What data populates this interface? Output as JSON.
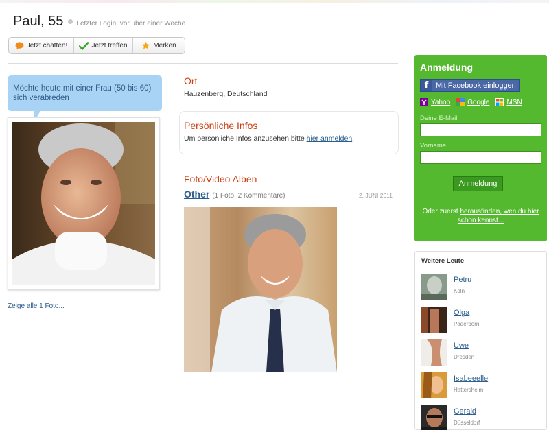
{
  "profile": {
    "name": "Paul, 55",
    "last_login": "Letzter Login: vor über einer Woche"
  },
  "actions": [
    {
      "label": "Jetzt chatten!",
      "icon": "chat-bubble-icon"
    },
    {
      "label": "Jetzt treffen",
      "icon": "checkmark-icon"
    },
    {
      "label": "Merken",
      "icon": "star-icon"
    }
  ],
  "bubble_text": "Möchte heute mit einer Frau (50 bis 60) sich verabreden",
  "show_all_photos": "Zeige alle 1 Foto...",
  "location": {
    "title": "Ort",
    "value": "Hauzenberg, Deutschland"
  },
  "personal_info": {
    "title": "Persönliche Infos",
    "text_before": "Um persönliche Infos anzusehen bitte ",
    "link": "hier anmelden",
    "text_after": "."
  },
  "albums": {
    "title": "Foto/Video Alben",
    "items": [
      {
        "name": "Other",
        "meta": "(1 Foto, 2 Kommentare)",
        "date": "2. JUNI 2011"
      }
    ]
  },
  "login": {
    "title": "Anmeldung",
    "facebook_label": "Mit Facebook einloggen",
    "providers": [
      {
        "label": "Yahoo",
        "icon": "yahoo-icon",
        "color": "#7b0099"
      },
      {
        "label": "Google",
        "icon": "google-icon",
        "color": "#4285f4"
      },
      {
        "label": "MSN",
        "icon": "msn-icon",
        "color": "#3a7bd5"
      }
    ],
    "email_label": "Deine E-Mail",
    "email_value": "",
    "firstname_label": "Vorname",
    "firstname_value": "",
    "submit_label": "Anmeldung",
    "footer_before": "Oder zuerst ",
    "footer_link": "herausfinden, wen du hier schon kennst...",
    "accent": "#55b92f"
  },
  "more_people": {
    "title": "Weitere Leute",
    "people": [
      {
        "name": "Petru",
        "city": "Köln"
      },
      {
        "name": "Olga",
        "city": "Paderborn"
      },
      {
        "name": "Uwe",
        "city": "Dresden"
      },
      {
        "name": "Isabeeelle",
        "city": "Hattersheim"
      },
      {
        "name": "Gerald",
        "city": "Düsseldorf"
      }
    ]
  }
}
